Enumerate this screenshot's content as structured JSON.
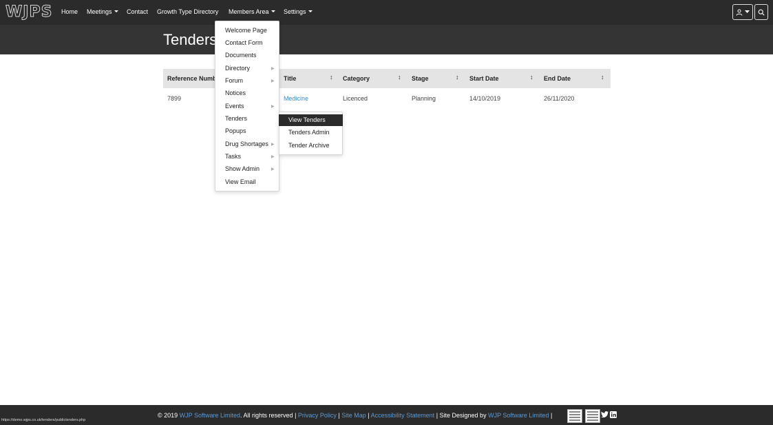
{
  "nav": {
    "logo": "WJPS",
    "items": [
      "Home",
      "Meetings",
      "Contact",
      "Growth Type Directory",
      "Members Area",
      "Settings"
    ]
  },
  "page": {
    "title": "Tenders"
  },
  "table": {
    "columns": [
      "Reference Numb",
      "Title",
      "Category",
      "Stage",
      "Start Date",
      "End Date"
    ],
    "sort_icon": "↕",
    "rows": [
      {
        "reference": "7899",
        "title": "Medicine",
        "category": "Licenced",
        "stage": "Planning",
        "start_date": "14/10/2019",
        "end_date": "26/11/2020"
      }
    ]
  },
  "members_menu": {
    "items": [
      "Welcome Page",
      "Contact Form",
      "Documents",
      "Directory",
      "Forum",
      "Notices",
      "Events",
      "Tenders",
      "Popups",
      "Drug Shortages",
      "Tasks",
      "Show Admin",
      "View Email"
    ]
  },
  "tenders_submenu": {
    "items": [
      "View Tenders",
      "Tenders Admin",
      "Tender Archive"
    ]
  },
  "footer": {
    "copyright": "© 2019 ",
    "company_link": "WJP Software Limited",
    "rights": ". All rights reserved | ",
    "privacy": "Privacy Policy",
    "sep1": " | ",
    "sitemap": "Site Map",
    "sep2": " | ",
    "accessibility": "Accessibility Statement",
    "designed": " | Site Designed by ",
    "designer_link": "WJP Software Limited",
    "sep3": " |",
    "status_url": "https://demo.wjps.co.uk/tenders/publictenders.php"
  },
  "icons": {
    "user": "user-icon",
    "search": "search-icon",
    "twitter": "twitter-icon",
    "linkedin": "linkedin-icon"
  },
  "colors": {
    "navbar": "#2b2b2b",
    "link": "#3a8bd4",
    "active_menu": "#2b2b2b"
  }
}
